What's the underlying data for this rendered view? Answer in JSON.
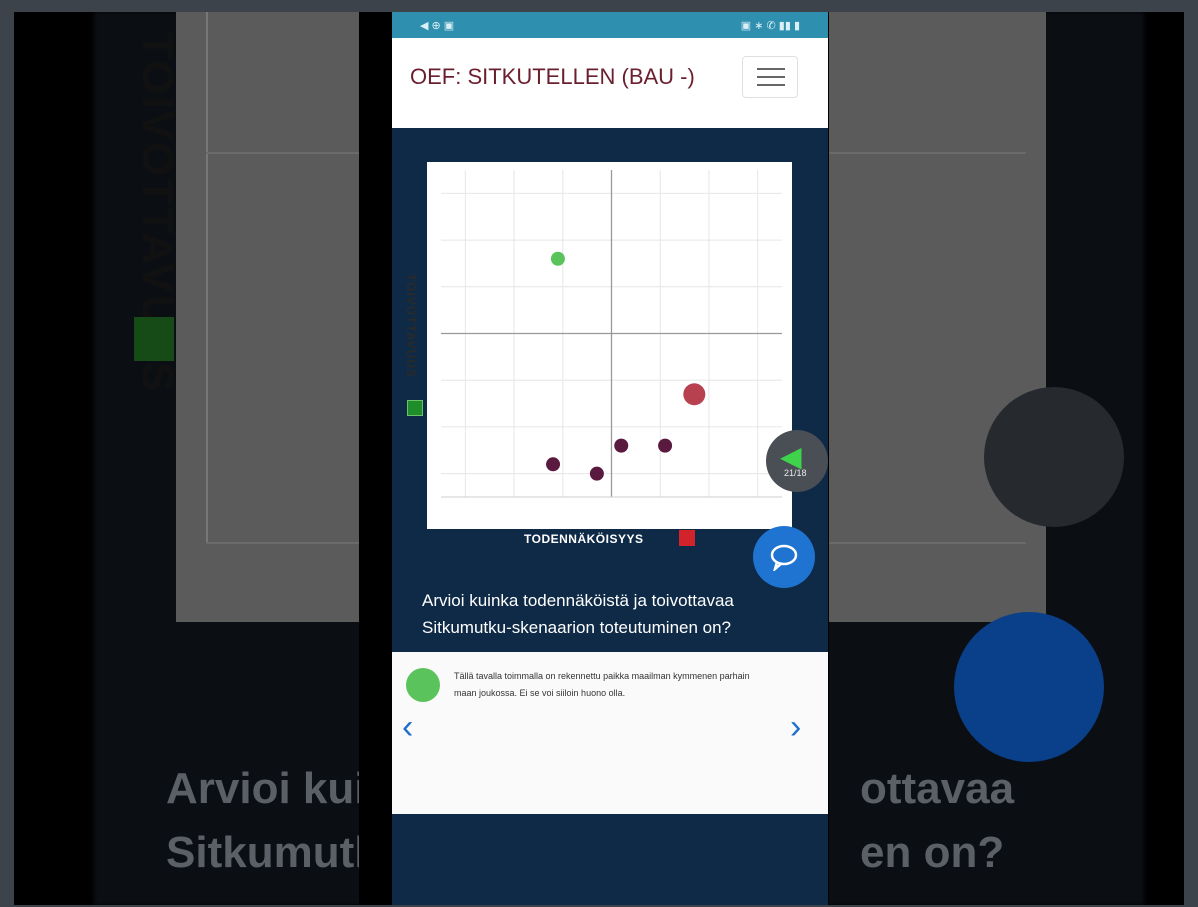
{
  "app": {
    "title": "OEF: SITKUTELLEN (BAU -)"
  },
  "chart": {
    "y_axis_label": "TOIVOTTAVUUS",
    "x_axis_label": "TODENNÄKÖISYYS",
    "nav_count": "21/18",
    "colors": {
      "plot_bg": "#ffffff",
      "grid": "#e6e6e6",
      "axis": "#999999",
      "good": "#5ac35c",
      "bad_dark": "#5a1a3f",
      "bad_pink": "#b8414f"
    }
  },
  "chart_data": {
    "type": "scatter",
    "xlabel": "TODENNÄKÖISYYS",
    "ylabel": "TOIVOTTAVUUS",
    "points": [
      {
        "x": -1.1,
        "y": 1.6,
        "size": 1,
        "color": "#5ac35c"
      },
      {
        "x": 1.7,
        "y": -1.3,
        "size": 2,
        "color": "#b8414f"
      },
      {
        "x": 0.2,
        "y": -2.4,
        "size": 1,
        "color": "#5a1a3f"
      },
      {
        "x": 1.1,
        "y": -2.4,
        "size": 1,
        "color": "#5a1a3f"
      },
      {
        "x": -1.2,
        "y": -2.8,
        "size": 1,
        "color": "#5a1a3f"
      },
      {
        "x": -0.3,
        "y": -3.0,
        "size": 1,
        "color": "#5a1a3f"
      }
    ],
    "grid": true
  },
  "question": "Arvioi kuinka todennäköistä ja toivottavaa Sitkumutku-skenaarion toteutuminen on?",
  "card": {
    "text": "Tällä tavalla toimmalla on rekennettu paikka maailman kymmenen parhain maan joukossa. Ei se voi siiloin huono olla.",
    "prev": "‹",
    "next": "›"
  },
  "background": {
    "y_label": "TOIVOTTAVUUS",
    "question_left": "Arvioi kui\nSitkumutk",
    "question_right": "ottavaa\nen on?"
  }
}
